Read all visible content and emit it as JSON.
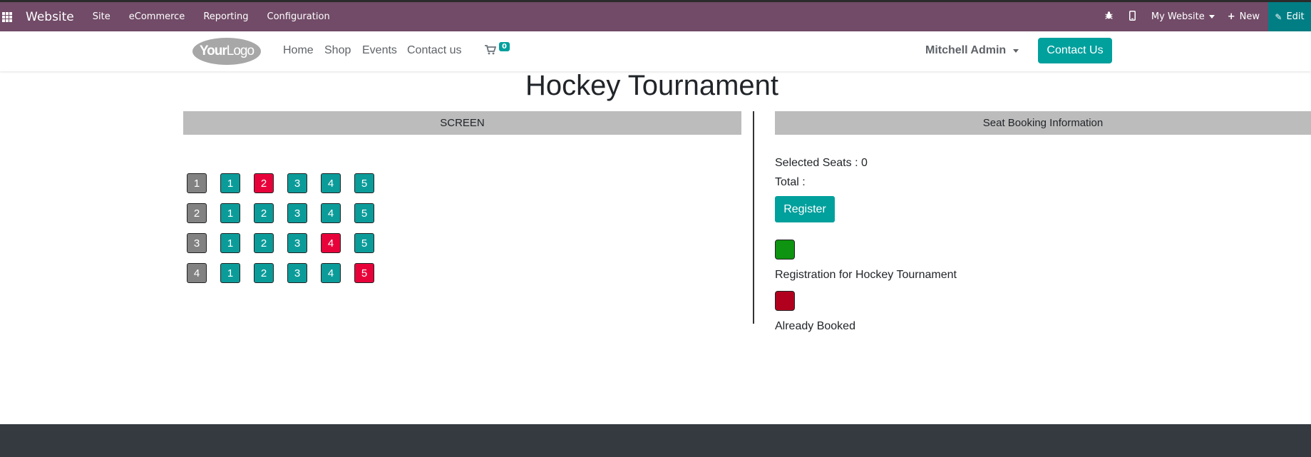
{
  "odoo_bar": {
    "app_name": "Website",
    "menu": [
      "Site",
      "eCommerce",
      "Reporting",
      "Configuration"
    ],
    "website_selector": "My Website",
    "new_label": "New",
    "edit_label": "Edit",
    "color": "#714b67",
    "edit_color": "#017e84"
  },
  "site_nav": {
    "logo_part1": "Your",
    "logo_part2": "Logo",
    "links": [
      "Home",
      "Shop",
      "Events",
      "Contact us"
    ],
    "cart_count": "0",
    "user": "Mitchell Admin",
    "contact_button": "Contact Us",
    "accent": "#00a09d"
  },
  "page": {
    "title": "Hockey Tournament",
    "screen_label": "SCREEN",
    "info_header": "Seat Booking Information",
    "selected_seats": "Selected Seats : 0",
    "total": "Total :",
    "register_label": "Register",
    "legend": [
      {
        "color": "#0e9410",
        "label": "Registration for Hockey Tournament"
      },
      {
        "color": "#b1001e",
        "label": "Already Booked"
      }
    ]
  },
  "seat_map": {
    "rows": [
      {
        "label": "1",
        "seats": [
          {
            "n": "1",
            "status": "available"
          },
          {
            "n": "2",
            "status": "booked"
          },
          {
            "n": "3",
            "status": "available"
          },
          {
            "n": "4",
            "status": "available"
          },
          {
            "n": "5",
            "status": "available"
          }
        ]
      },
      {
        "label": "2",
        "seats": [
          {
            "n": "1",
            "status": "available"
          },
          {
            "n": "2",
            "status": "available"
          },
          {
            "n": "3",
            "status": "available"
          },
          {
            "n": "4",
            "status": "available"
          },
          {
            "n": "5",
            "status": "available"
          }
        ]
      },
      {
        "label": "3",
        "seats": [
          {
            "n": "1",
            "status": "available"
          },
          {
            "n": "2",
            "status": "available"
          },
          {
            "n": "3",
            "status": "available"
          },
          {
            "n": "4",
            "status": "booked"
          },
          {
            "n": "5",
            "status": "available"
          }
        ]
      },
      {
        "label": "4",
        "seats": [
          {
            "n": "1",
            "status": "available"
          },
          {
            "n": "2",
            "status": "available"
          },
          {
            "n": "3",
            "status": "available"
          },
          {
            "n": "4",
            "status": "available"
          },
          {
            "n": "5",
            "status": "booked"
          }
        ]
      }
    ],
    "available_color": "#0b9c9a",
    "booked_color": "#e8023a",
    "row_label_color": "#828282"
  }
}
